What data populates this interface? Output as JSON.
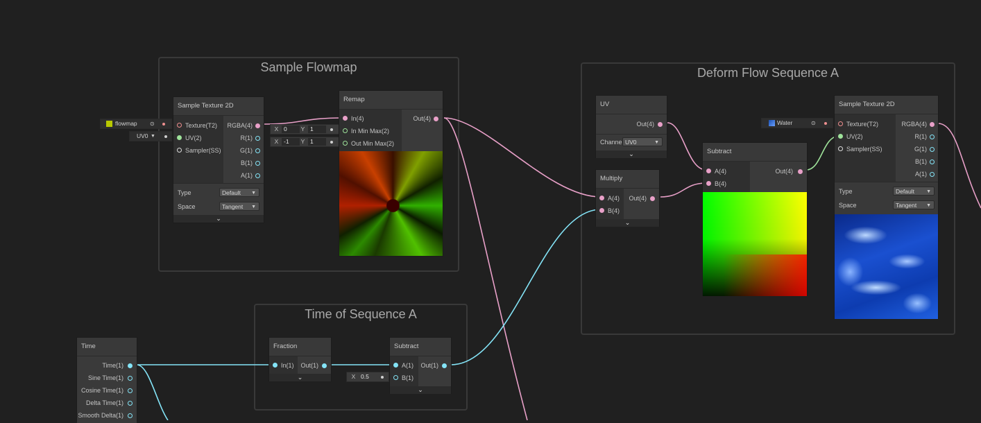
{
  "groups": {
    "sample_flowmap": "Sample Flowmap",
    "time_of_sequence_a": "Time of Sequence A",
    "deform_flow_sequence_a": "Deform Flow Sequence A"
  },
  "nodes": {
    "sample_texture_1": {
      "title": "Sample Texture 2D",
      "inputs": [
        "Texture(T2)",
        "UV(2)",
        "Sampler(SS)"
      ],
      "outputs": [
        "RGBA(4)",
        "R(1)",
        "G(1)",
        "B(1)",
        "A(1)"
      ],
      "type_label": "Type",
      "type_value": "Default",
      "space_label": "Space",
      "space_value": "Tangent"
    },
    "remap": {
      "title": "Remap",
      "inputs": [
        "In(4)",
        "In Min Max(2)",
        "Out Min Max(2)"
      ],
      "outputs": [
        "Out(4)"
      ]
    },
    "uv": {
      "title": "UV",
      "outputs": [
        "Out(4)"
      ],
      "channel_label": "Channe",
      "channel_value": "UV0"
    },
    "multiply": {
      "title": "Multiply",
      "inputs": [
        "A(4)",
        "B(4)"
      ],
      "outputs": [
        "Out(4)"
      ]
    },
    "subtract_1": {
      "title": "Subtract",
      "inputs": [
        "A(4)",
        "B(4)"
      ],
      "outputs": [
        "Out(4)"
      ]
    },
    "sample_texture_2": {
      "title": "Sample Texture 2D",
      "inputs": [
        "Texture(T2)",
        "UV(2)",
        "Sampler(SS)"
      ],
      "outputs": [
        "RGBA(4)",
        "R(1)",
        "G(1)",
        "B(1)",
        "A(1)"
      ],
      "type_label": "Type",
      "type_value": "Default",
      "space_label": "Space",
      "space_value": "Tangent"
    },
    "time": {
      "title": "Time",
      "outputs": [
        "Time(1)",
        "Sine Time(1)",
        "Cosine Time(1)",
        "Delta Time(1)",
        "Smooth Delta(1)"
      ]
    },
    "fraction": {
      "title": "Fraction",
      "inputs": [
        "In(1)"
      ],
      "outputs": [
        "Out(1)"
      ]
    },
    "subtract_2": {
      "title": "Subtract",
      "inputs": [
        "A(1)",
        "B(1)"
      ],
      "outputs": [
        "Out(1)"
      ]
    }
  },
  "inline_inputs": {
    "flowmap": "flowmap",
    "uv0": "UV0",
    "in_min_x_label": "X",
    "in_min_x": "0",
    "in_min_y_label": "Y",
    "in_min_y": "1",
    "out_min_x_label": "X",
    "out_min_x": "-1",
    "out_min_y_label": "Y",
    "out_min_y": "1",
    "water": "Water",
    "b_x_label": "X",
    "b_x": "0.5"
  },
  "colors": {
    "background": "#202020",
    "node": "#393939",
    "vector4_wire": "#e8a0c8",
    "float_wire": "#84e4f7",
    "vector2_wire": "#9ee29a",
    "texture_port": "#ef8f8f"
  }
}
